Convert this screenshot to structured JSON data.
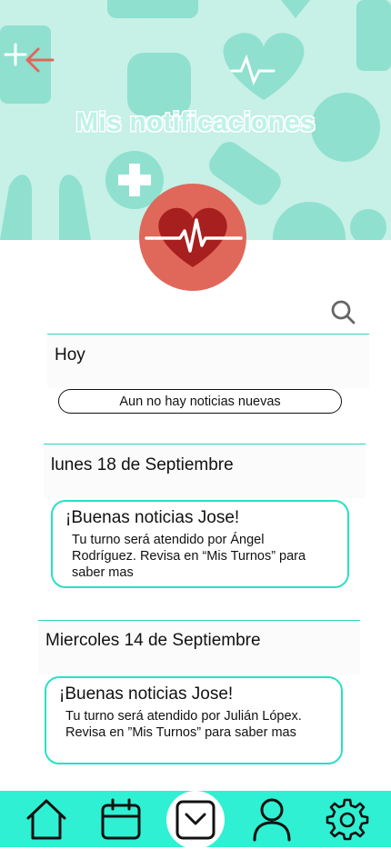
{
  "header": {
    "title": "Mis notificaciones",
    "back_icon": "arrow-left-icon",
    "avatar_icon": "heart-pulse-icon",
    "bg_color": "#c7f0e7",
    "accent_color": "#e0685a"
  },
  "search": {
    "icon": "search-icon"
  },
  "sections": [
    {
      "heading": "Hoy",
      "empty_message": "Aun no hay noticias nuevas"
    },
    {
      "heading": "lunes 18 de Septiembre",
      "card": {
        "title": "¡Buenas noticias Jose!",
        "body": "Tu turno será atendido por Ángel Rodríguez. Revisa en “Mis Turnos” para saber mas"
      }
    },
    {
      "heading": "Miercoles 14 de Septiembre",
      "card": {
        "title": "¡Buenas noticias Jose!",
        "body": "Tu turno será atendido por Julián Lópex. Revisa en ”Mis Turnos” para saber mas"
      }
    }
  ],
  "nav": {
    "items": [
      "home-icon",
      "calendar-icon",
      "inbox-icon",
      "user-icon",
      "settings-icon"
    ],
    "active": "inbox-icon",
    "bg_color": "#2ff0d2"
  }
}
